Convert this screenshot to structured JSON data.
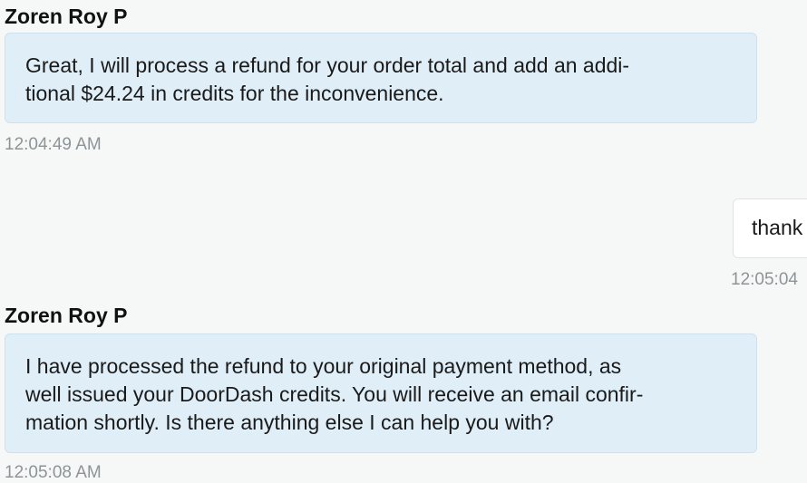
{
  "messages": [
    {
      "sender": "Zoren Roy P",
      "lines": [
        "Great, I will process a refund for your order total and add an addi-",
        "tional $24.24 in credits for the inconvenience."
      ],
      "timestamp": "12:04:49 AM"
    },
    {
      "sender": "",
      "text": "thank",
      "timestamp": "12:05:04"
    },
    {
      "sender": "Zoren Roy P",
      "lines": [
        "I have processed the refund to your original payment method, as",
        "well issued your DoorDash credits. You will receive an email confir-",
        "mation shortly. Is there anything else I can help you with?"
      ],
      "timestamp": "12:05:08 AM"
    }
  ],
  "colors": {
    "background": "#f6f8f8",
    "agent_bubble": "#dfeef7",
    "user_bubble": "#ffffff",
    "timestamp": "#8e9496"
  }
}
